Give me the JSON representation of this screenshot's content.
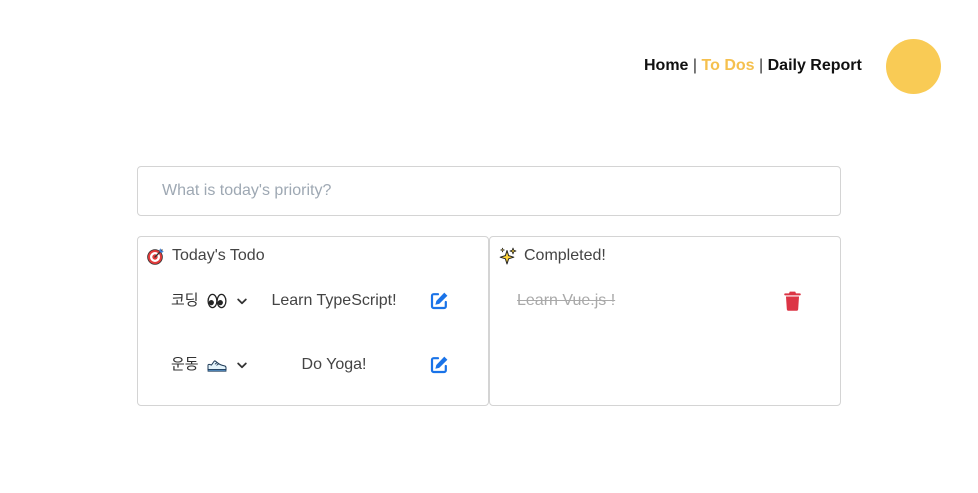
{
  "nav": {
    "items": [
      {
        "label": "Home",
        "active": false
      },
      {
        "label": "To Dos",
        "active": true
      },
      {
        "label": "Daily Report",
        "active": false
      }
    ],
    "separator": "|"
  },
  "colors": {
    "accent": "#F9CB55",
    "accent_text": "#F5C04E",
    "edit": "#1a73e8",
    "delete": "#dc3545"
  },
  "todo_input": {
    "placeholder": "What is today's priority?",
    "value": ""
  },
  "todo_panel": {
    "title": "Today's Todo",
    "icon": "direct-hit-icon",
    "items": [
      {
        "category": "코딩",
        "category_icon": "eyes-icon",
        "text": "Learn TypeScript!",
        "action_icon": "edit-icon"
      },
      {
        "category": "운동",
        "category_icon": "running-shoe-icon",
        "text": "Do Yoga!",
        "action_icon": "edit-icon"
      }
    ]
  },
  "completed_panel": {
    "title": "Completed!",
    "icon": "sparkles-icon",
    "items": [
      {
        "text": "Learn Vue.js !",
        "action_icon": "trash-icon"
      }
    ]
  }
}
